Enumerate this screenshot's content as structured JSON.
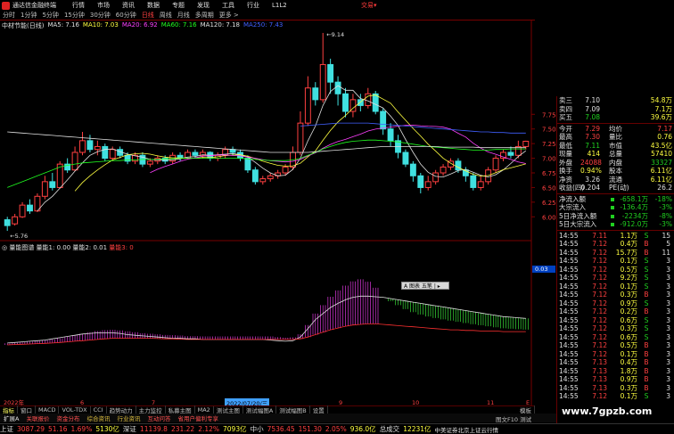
{
  "titlebar": {
    "app_name": "通达信金融终端",
    "menus": [
      "行情",
      "市场",
      "资讯",
      "数据",
      "专题",
      "发现",
      "工具",
      "行业",
      "L1L2"
    ],
    "trade_link": "交易▾"
  },
  "periods": [
    {
      "label": "分时",
      "active": false
    },
    {
      "label": "1分钟",
      "active": false
    },
    {
      "label": "5分钟",
      "active": false
    },
    {
      "label": "15分钟",
      "active": false
    },
    {
      "label": "30分钟",
      "active": false
    },
    {
      "label": "60分钟",
      "active": false
    },
    {
      "label": "日线",
      "active": true
    },
    {
      "label": "周线",
      "active": false
    },
    {
      "label": "月线",
      "active": false
    },
    {
      "label": "多周期",
      "active": false
    },
    {
      "label": "更多 >",
      "active": false
    }
  ],
  "ma_legend": [
    {
      "text": "中材节能(日线)",
      "color": "#e0e0e0"
    },
    {
      "text": "MA5: 7.16",
      "color": "#e0e0e0"
    },
    {
      "text": "MA10: 7.03",
      "color": "#ffff40"
    },
    {
      "text": "MA20: 6.92",
      "color": "#ff40ff"
    },
    {
      "text": "MA60: 7.16",
      "color": "#20ff20"
    },
    {
      "text": "MA120: 7.18",
      "color": "#e0e0e0"
    },
    {
      "text": "MA250: 7.43",
      "color": "#4060ff"
    }
  ],
  "vol_legend": [
    {
      "text": "◎ 量能图谱 量能1: 0.00",
      "color": "#e0e0e0"
    },
    {
      "text": "量能2: 0.01",
      "color": "#e0e0e0"
    },
    {
      "text": "量能3: 0",
      "color": "#ff4040"
    }
  ],
  "chart_data": {
    "type": "candlestick",
    "price_axis": [
      7.75,
      7.5,
      7.25,
      7.0,
      6.75,
      6.5,
      6.25,
      6.0
    ],
    "ylim": [
      5.7,
      9.2
    ],
    "high_label": "9.14",
    "low_label": "5.76",
    "candles": [
      [
        5.95,
        5.85,
        6.0,
        5.76
      ],
      [
        5.88,
        6.0,
        6.05,
        5.85
      ],
      [
        6.0,
        6.2,
        6.25,
        5.98
      ],
      [
        6.2,
        6.1,
        6.3,
        6.05
      ],
      [
        6.1,
        6.35,
        6.4,
        6.08
      ],
      [
        6.35,
        6.6,
        6.7,
        6.3
      ],
      [
        6.6,
        6.5,
        6.75,
        6.45
      ],
      [
        6.5,
        6.9,
        6.95,
        6.48
      ],
      [
        6.9,
        6.8,
        7.0,
        6.75
      ],
      [
        6.8,
        7.1,
        7.2,
        6.78
      ],
      [
        7.1,
        7.3,
        7.45,
        7.05
      ],
      [
        7.3,
        7.15,
        7.4,
        7.1
      ],
      [
        7.15,
        7.2,
        7.3,
        7.05
      ],
      [
        7.2,
        7.0,
        7.25,
        6.95
      ],
      [
        7.0,
        7.15,
        7.2,
        6.95
      ],
      [
        7.15,
        7.05,
        7.2,
        7.0
      ],
      [
        7.05,
        6.95,
        7.1,
        6.9
      ],
      [
        6.95,
        7.05,
        7.1,
        6.9
      ],
      [
        7.05,
        6.9,
        7.1,
        6.85
      ],
      [
        6.9,
        6.95,
        7.0,
        6.85
      ],
      [
        6.95,
        7.0,
        7.05,
        6.9
      ],
      [
        7.0,
        6.95,
        7.05,
        6.9
      ],
      [
        6.95,
        7.05,
        7.1,
        6.9
      ],
      [
        7.05,
        7.0,
        7.1,
        6.95
      ],
      [
        7.0,
        7.1,
        7.15,
        6.98
      ],
      [
        7.1,
        7.05,
        7.15,
        7.0
      ],
      [
        7.05,
        7.1,
        7.15,
        7.0
      ],
      [
        7.1,
        7.0,
        7.12,
        6.95
      ],
      [
        7.0,
        7.05,
        7.1,
        6.95
      ],
      [
        7.05,
        7.15,
        7.2,
        7.0
      ],
      [
        7.15,
        7.1,
        7.2,
        7.05
      ],
      [
        7.1,
        7.0,
        7.15,
        6.95
      ],
      [
        7.0,
        6.8,
        7.05,
        6.75
      ],
      [
        6.8,
        6.6,
        6.85,
        6.55
      ],
      [
        6.6,
        6.65,
        6.7,
        6.55
      ],
      [
        6.65,
        6.7,
        6.75,
        6.6
      ],
      [
        6.7,
        6.75,
        6.8,
        6.65
      ],
      [
        6.75,
        6.85,
        6.9,
        6.7
      ],
      [
        6.85,
        7.1,
        7.2,
        6.8
      ],
      [
        7.1,
        7.6,
        7.8,
        7.05
      ],
      [
        7.6,
        8.2,
        8.4,
        7.55
      ],
      [
        8.2,
        8.0,
        8.3,
        7.9
      ],
      [
        8.0,
        8.6,
        9.14,
        7.95
      ],
      [
        8.6,
        8.3,
        8.7,
        8.1
      ],
      [
        8.3,
        8.1,
        8.4,
        7.9
      ],
      [
        8.1,
        7.8,
        8.2,
        7.7
      ],
      [
        7.8,
        8.0,
        8.1,
        7.7
      ],
      [
        8.0,
        7.9,
        8.1,
        7.8
      ],
      [
        7.9,
        8.1,
        8.2,
        7.85
      ],
      [
        8.1,
        7.8,
        8.15,
        7.75
      ],
      [
        7.8,
        7.5,
        7.85,
        7.4
      ],
      [
        7.5,
        7.3,
        7.6,
        7.2
      ],
      [
        7.3,
        7.1,
        7.4,
        7.0
      ],
      [
        7.1,
        6.9,
        7.15,
        6.85
      ],
      [
        6.9,
        6.7,
        6.95,
        6.6
      ],
      [
        6.7,
        6.5,
        6.75,
        6.4
      ],
      [
        6.5,
        6.6,
        6.7,
        6.45
      ],
      [
        6.6,
        6.75,
        6.8,
        6.55
      ],
      [
        6.75,
        6.85,
        6.9,
        6.7
      ],
      [
        6.85,
        6.95,
        7.0,
        6.8
      ],
      [
        6.95,
        6.8,
        7.0,
        6.75
      ],
      [
        6.8,
        6.7,
        6.85,
        6.6
      ],
      [
        6.7,
        6.5,
        6.75,
        6.45
      ],
      [
        6.5,
        6.6,
        6.7,
        6.45
      ],
      [
        6.6,
        6.8,
        6.85,
        6.55
      ],
      [
        6.8,
        7.0,
        7.05,
        6.75
      ],
      [
        7.0,
        7.1,
        7.15,
        6.95
      ],
      [
        7.1,
        7.05,
        7.2,
        7.0
      ],
      [
        7.05,
        7.2,
        7.3,
        7.0
      ],
      [
        7.2,
        7.29,
        7.3,
        7.15
      ]
    ],
    "ma_lines": [
      {
        "name": "MA5",
        "color": "#e0e0e0",
        "period": 5
      },
      {
        "name": "MA10",
        "color": "#ffff40",
        "period": 10
      },
      {
        "name": "MA20",
        "color": "#ff40ff",
        "period": 20
      },
      {
        "name": "MA60",
        "color": "#20ff20",
        "values": [
          6.5,
          6.55,
          6.6,
          6.65,
          6.7,
          6.75,
          6.8,
          6.85,
          6.88,
          6.9,
          6.92,
          6.93,
          6.94,
          6.95,
          6.96,
          6.96,
          6.97,
          6.97,
          6.98,
          6.98,
          6.98,
          6.99,
          6.99,
          7.0,
          7.0,
          7.0,
          7.0,
          7.0,
          7.0,
          7.0,
          7.0,
          7.0,
          6.99,
          6.98,
          6.97,
          6.96,
          6.96,
          6.96,
          6.97,
          7.0,
          7.05,
          7.1,
          7.16,
          7.2,
          7.24,
          7.27,
          7.29,
          7.3,
          7.31,
          7.31,
          7.3,
          7.29,
          7.28,
          7.26,
          7.24,
          7.22,
          7.2,
          7.19,
          7.18,
          7.17,
          7.16,
          7.15,
          7.14,
          7.14,
          7.14,
          7.15,
          7.15,
          7.16,
          7.16,
          7.16
        ]
      },
      {
        "name": "MA120",
        "color": "#e0e0e0",
        "values": [
          7.45,
          7.44,
          7.43,
          7.42,
          7.41,
          7.4,
          7.39,
          7.38,
          7.37,
          7.36,
          7.35,
          7.34,
          7.33,
          7.32,
          7.31,
          7.3,
          7.29,
          7.28,
          7.27,
          7.26,
          7.25,
          7.24,
          7.23,
          7.22,
          7.21,
          7.2,
          7.19,
          7.18,
          7.17,
          7.16,
          7.15,
          7.14,
          7.13,
          7.12,
          7.11,
          7.1,
          7.1,
          7.1,
          7.1,
          7.1,
          7.1,
          7.11,
          7.12,
          7.13,
          7.14,
          7.15,
          7.16,
          7.17,
          7.18,
          7.19,
          7.2,
          7.2,
          7.2,
          7.2,
          7.2,
          7.2,
          7.2,
          7.2,
          7.19,
          7.19,
          7.19,
          7.19,
          7.19,
          7.18,
          7.18,
          7.18,
          7.18,
          7.18,
          7.18,
          7.18
        ]
      },
      {
        "name": "MA250",
        "color": "#4060ff",
        "values": [
          null,
          null,
          null,
          null,
          null,
          null,
          null,
          null,
          null,
          null,
          null,
          null,
          null,
          null,
          null,
          null,
          null,
          null,
          null,
          null,
          null,
          null,
          null,
          null,
          null,
          null,
          null,
          null,
          null,
          null,
          null,
          null,
          null,
          null,
          null,
          null,
          null,
          null,
          null,
          7.55,
          7.56,
          7.57,
          7.58,
          7.59,
          7.6,
          7.6,
          7.6,
          7.6,
          7.6,
          7.59,
          7.58,
          7.57,
          7.56,
          7.55,
          7.54,
          7.53,
          7.52,
          7.51,
          7.5,
          7.49,
          7.48,
          7.47,
          7.46,
          7.45,
          7.45,
          7.44,
          7.44,
          7.43,
          7.43,
          7.43
        ]
      }
    ],
    "indicator": {
      "bars": [
        0.5,
        0.6,
        0.7,
        0.8,
        0.9,
        1.0,
        1.2,
        1.4,
        1.7,
        2.0,
        2.3,
        2.6,
        2.8,
        2.9,
        2.8,
        2.6,
        2.3,
        2.0,
        1.7,
        1.5,
        1.4,
        1.3,
        1.2,
        1.2,
        1.1,
        1.1,
        1.0,
        1.0,
        1.0,
        1.0,
        1.0,
        1.0,
        1.0,
        1.0,
        1.0,
        1.0,
        0.8,
        0.6,
        0.7,
        1.5,
        4.0,
        7.0,
        9.0,
        11.0,
        12.5,
        13.5,
        14.5,
        15.0,
        14.0,
        12.0,
        -0.2,
        -1.5,
        -3.0,
        -4.5,
        -5.5,
        -6.2,
        -6.6,
        -6.8,
        -6.9,
        -6.9,
        -6.9,
        -6.9,
        -6.9,
        -6.8,
        -6.7,
        -6.6,
        -6.5,
        -6.4,
        -6.3,
        -6.2
      ],
      "line1": [
        0.6,
        0.7,
        0.8,
        0.9,
        1.0,
        1.1,
        1.3,
        1.5,
        1.7,
        1.9,
        2.1,
        2.2,
        2.3,
        2.3,
        2.3,
        2.2,
        2.0,
        1.9,
        1.8,
        1.7,
        1.6,
        1.5,
        1.4,
        1.4,
        1.3,
        1.3,
        1.2,
        1.2,
        1.2,
        1.2,
        1.2,
        1.2,
        1.2,
        1.2,
        1.2,
        1.1,
        1.0,
        0.9,
        1.0,
        1.6,
        3.0,
        4.5,
        5.5,
        6.5,
        7.2,
        7.8,
        8.2,
        8.4,
        8.4,
        8.3,
        8.2,
        8.0,
        7.8,
        7.6,
        7.4,
        7.2,
        7.0,
        6.8,
        6.6,
        6.4,
        6.2,
        6.0,
        5.8,
        5.6,
        5.4,
        5.2,
        5.0,
        4.9,
        4.8,
        4.7
      ],
      "line2": [
        0.3,
        0.35,
        0.4,
        0.45,
        0.5,
        0.55,
        0.6,
        0.7,
        0.8,
        0.9,
        1.0,
        1.1,
        1.2,
        1.3,
        1.4,
        1.4,
        1.4,
        1.4,
        1.4,
        1.4,
        1.35,
        1.3,
        1.3,
        1.25,
        1.2,
        1.2,
        1.2,
        1.2,
        1.2,
        1.2,
        1.2,
        1.2,
        1.2,
        1.2,
        1.2,
        1.2,
        1.2,
        1.2,
        1.2,
        1.3,
        1.6,
        2.0,
        2.4,
        2.8,
        3.1,
        3.4,
        3.6,
        3.7,
        3.8,
        3.8,
        3.7,
        3.6,
        3.5,
        3.4,
        3.3,
        3.2,
        3.1,
        3.0,
        2.9,
        2.8,
        2.8,
        2.7,
        2.7,
        2.6,
        2.6,
        2.6,
        2.5,
        2.5,
        2.5,
        2.5
      ]
    },
    "bottom_axis": [
      "2022年",
      "6",
      "7",
      "8",
      "9",
      "10",
      "11",
      "E"
    ],
    "sub_scale_label": "0.03"
  },
  "popup_text": "A 图表 五笔 | ▸",
  "date_tag": "2022/07/20/三",
  "tabs": [
    "指标",
    "窗口",
    "MACD",
    "VOL-TDX",
    "CCI",
    "趋势动力",
    "主力监控",
    "私募主图",
    "MA2",
    "测试主图",
    "测试幅图A",
    "测试幅图B",
    "设置"
  ],
  "extra_tabs": [
    {
      "text": "扩展A",
      "style": "w"
    },
    {
      "text": "关联报价",
      "style": "r"
    },
    {
      "text": "资金分布",
      "style": "r"
    },
    {
      "text": "综合资讯",
      "style": "y"
    },
    {
      "text": "行业资讯",
      "style": "y"
    },
    {
      "text": "互动问答",
      "style": "r"
    },
    {
      "text": "省用户偏利专享",
      "style": "r"
    }
  ],
  "side_tab": "模板",
  "brand_tag": "图文F10 测试",
  "right_panel": {
    "asks": [
      {
        "label": "卖三",
        "price": "7.10",
        "vol": "54.8万"
      },
      {
        "label": "卖四",
        "price": "7.09",
        "vol": "7.1万"
      },
      {
        "label": "买五",
        "price": "7.08",
        "vol": "39.6万"
      }
    ],
    "stats": [
      {
        "l1": "今开",
        "v1": "7.29",
        "c1": "red",
        "l2": "均价",
        "v2": "7.17",
        "c2": "red"
      },
      {
        "l1": "最高",
        "v1": "7.30",
        "c1": "red",
        "l2": "量比",
        "v2": "0.76",
        "c2": "yellow"
      },
      {
        "l1": "最低",
        "v1": "7.11",
        "c1": "green",
        "l2": "市值",
        "v2": "43.5亿",
        "c2": "yellow"
      },
      {
        "l1": "现量",
        "v1": "414",
        "c1": "yellow",
        "l2": "总量",
        "v2": "57410",
        "c2": "yellow"
      },
      {
        "l1": "外盘",
        "v1": "24088",
        "c1": "red",
        "l2": "内盘",
        "v2": "33327",
        "c2": "green"
      },
      {
        "l1": "换手",
        "v1": "0.94%",
        "c1": "yellow",
        "l2": "股本",
        "v2": "6.11亿",
        "c2": "yellow"
      },
      {
        "l1": "净资",
        "v1": "3.26",
        "c1": "white",
        "l2": "流通",
        "v2": "6.11亿",
        "c2": "yellow"
      },
      {
        "l1": "收益(四)",
        "v1": "0.204",
        "c1": "white",
        "l2": "PE(动)",
        "v2": "26.2",
        "c2": "white"
      }
    ],
    "flows": [
      {
        "label": "净流入额",
        "value": "-658.1万",
        "pct": "-18%"
      },
      {
        "label": "大宗流入",
        "value": "-136.4万",
        "pct": "-3%"
      },
      {
        "label": "5日净流入额",
        "value": "-2234万",
        "pct": "-8%"
      },
      {
        "label": "5日大宗流入",
        "value": "-912.0万",
        "pct": "-3%"
      }
    ],
    "ticks": [
      {
        "time": "14:55",
        "price": "7.11",
        "vol": "1.1万",
        "side": "S",
        "count": "15"
      },
      {
        "time": "14:55",
        "price": "7.12",
        "vol": "0.4万",
        "side": "B",
        "count": "5"
      },
      {
        "time": "14:55",
        "price": "7.12",
        "vol": "15.7万",
        "side": "B",
        "count": "11"
      },
      {
        "time": "14:55",
        "price": "7.12",
        "vol": "0.1万",
        "side": "S",
        "count": "3"
      },
      {
        "time": "14:55",
        "price": "7.12",
        "vol": "0.5万",
        "side": "S",
        "count": "3"
      },
      {
        "time": "14:55",
        "price": "7.12",
        "vol": "9.2万",
        "side": "S",
        "count": "3"
      },
      {
        "time": "14:55",
        "price": "7.12",
        "vol": "0.1万",
        "side": "S",
        "count": "3"
      },
      {
        "time": "14:55",
        "price": "7.12",
        "vol": "0.3万",
        "side": "B",
        "count": "3"
      },
      {
        "time": "14:55",
        "price": "7.12",
        "vol": "0.9万",
        "side": "S",
        "count": "3"
      },
      {
        "time": "14:55",
        "price": "7.12",
        "vol": "0.2万",
        "side": "B",
        "count": "3"
      },
      {
        "time": "14:55",
        "price": "7.12",
        "vol": "0.6万",
        "side": "S",
        "count": "3"
      },
      {
        "time": "14:55",
        "price": "7.12",
        "vol": "0.3万",
        "side": "S",
        "count": "3"
      },
      {
        "time": "14:55",
        "price": "7.12",
        "vol": "0.6万",
        "side": "S",
        "count": "3"
      },
      {
        "time": "14:55",
        "price": "7.12",
        "vol": "0.5万",
        "side": "B",
        "count": "3"
      },
      {
        "time": "14:55",
        "price": "7.12",
        "vol": "0.1万",
        "side": "B",
        "count": "3"
      },
      {
        "time": "14:55",
        "price": "7.13",
        "vol": "0.4万",
        "side": "B",
        "count": "3"
      },
      {
        "time": "14:55",
        "price": "7.13",
        "vol": "1.8万",
        "side": "B",
        "count": "3"
      },
      {
        "time": "14:55",
        "price": "7.13",
        "vol": "0.9万",
        "side": "B",
        "count": "3"
      },
      {
        "time": "14:55",
        "price": "7.13",
        "vol": "0.3万",
        "side": "B",
        "count": "3"
      },
      {
        "time": "14:55",
        "price": "7.12",
        "vol": "0.1万",
        "side": "S",
        "count": "3"
      }
    ]
  },
  "status": [
    {
      "name": "上证",
      "value": "3087.29",
      "change": "51.16",
      "pct": "1.69%",
      "amount": "5130亿"
    },
    {
      "name": "深证",
      "value": "11139.8",
      "change": "231.22",
      "pct": "2.12%",
      "amount": "7093亿"
    },
    {
      "name": "中小",
      "value": "7536.45",
      "change": "151.30",
      "pct": "2.05%",
      "amount": "936.0亿"
    }
  ],
  "status_total": {
    "label": "总成交",
    "value": "12231亿",
    "extra": "中美证券北京上证云行情"
  },
  "watermark": "www.7gpzb.com"
}
